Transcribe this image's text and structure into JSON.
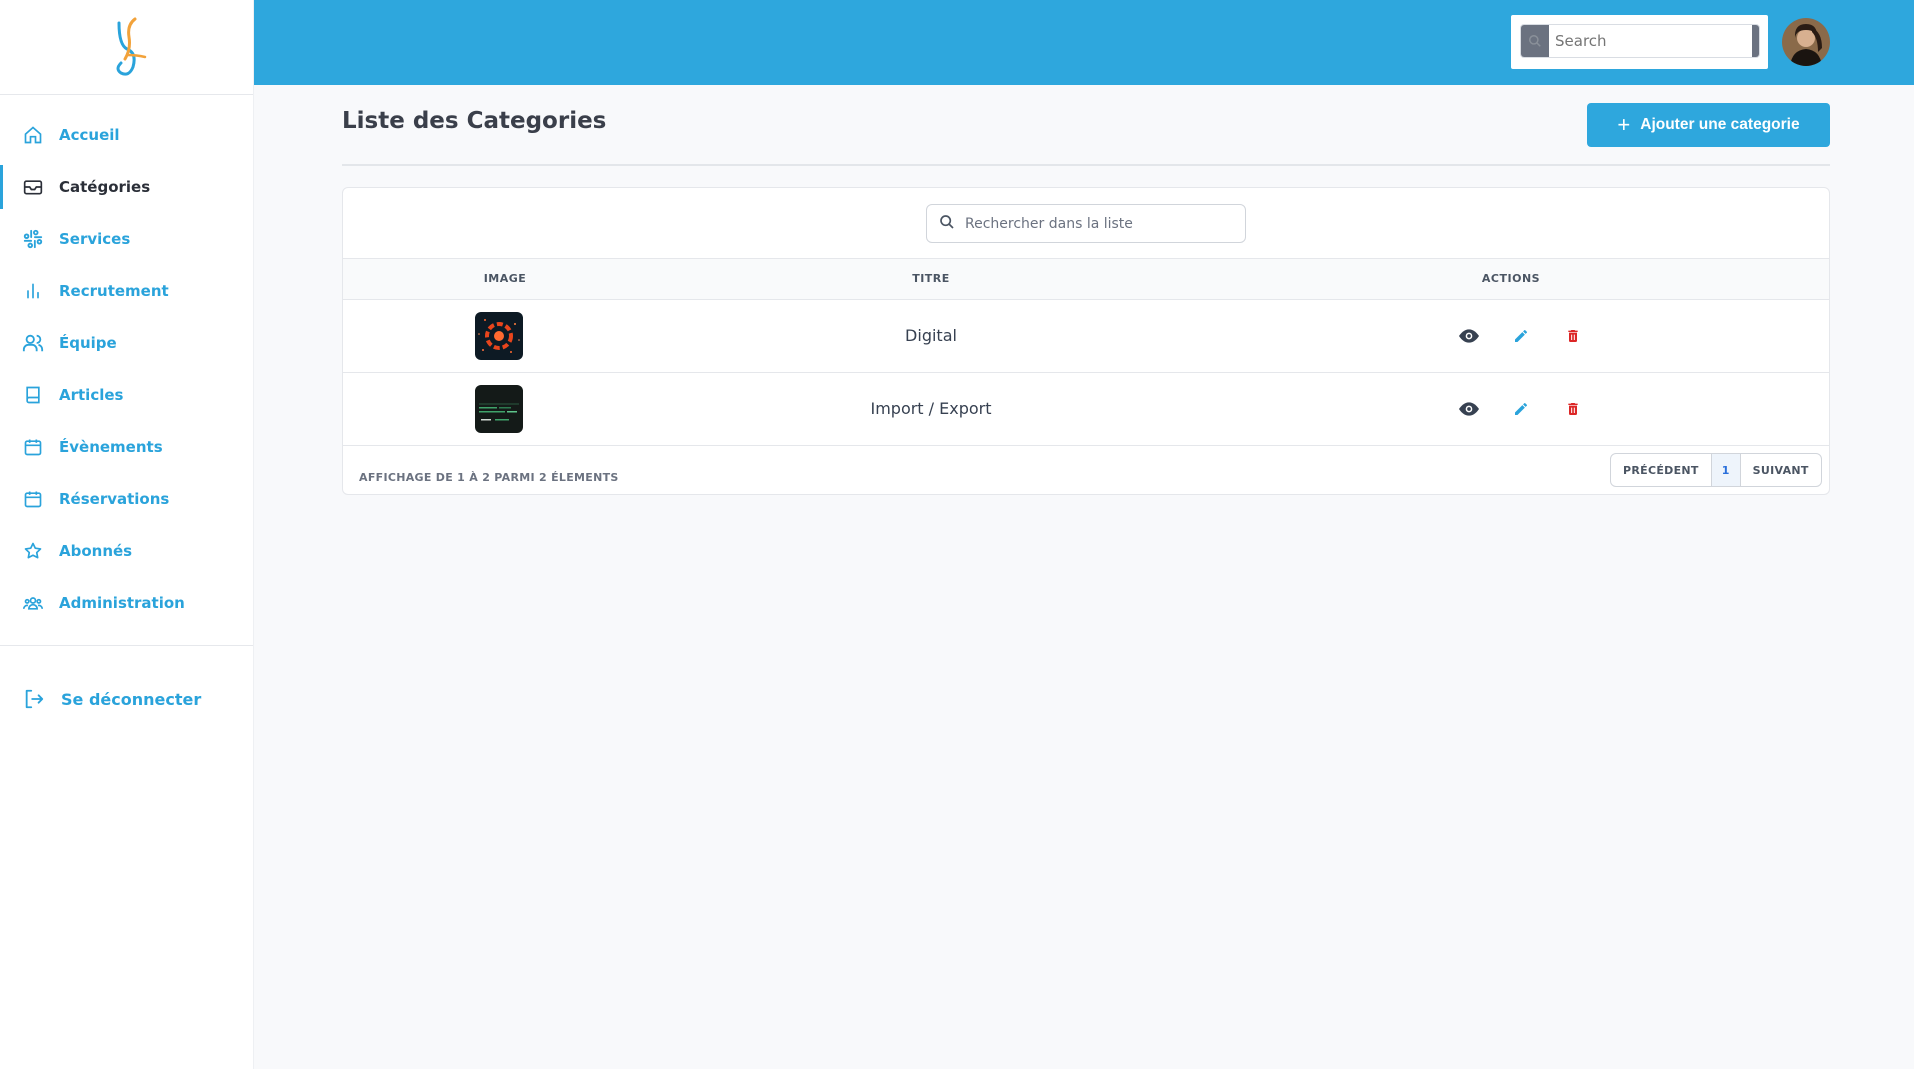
{
  "sidebar": {
    "logo": "brand-logo",
    "items": [
      {
        "label": "Accueil",
        "icon": "home-icon",
        "active": false
      },
      {
        "label": "Catégories",
        "icon": "inbox-icon",
        "active": true
      },
      {
        "label": "Services",
        "icon": "slack-icon",
        "active": false
      },
      {
        "label": "Recrutement",
        "icon": "bar-chart-icon",
        "active": false
      },
      {
        "label": "Équipe",
        "icon": "users-icon",
        "active": false
      },
      {
        "label": "Articles",
        "icon": "book-icon",
        "active": false
      },
      {
        "label": "Évènements",
        "icon": "calendar-icon",
        "active": false
      },
      {
        "label": "Réservations",
        "icon": "calendar-icon",
        "active": false
      },
      {
        "label": "Abonnés",
        "icon": "star-icon",
        "active": false
      },
      {
        "label": "Administration",
        "icon": "admin-group-icon",
        "active": false
      }
    ],
    "logout_label": "Se déconnecter"
  },
  "topbar": {
    "search_placeholder": "Search"
  },
  "main": {
    "title": "Liste des Categories",
    "add_button_label": "Ajouter une categorie",
    "list_search_placeholder": "Rechercher dans la liste",
    "table": {
      "headers": [
        "IMAGE",
        "TITRE",
        "ACTIONS"
      ],
      "rows": [
        {
          "title": "Digital"
        },
        {
          "title": "Import / Export"
        }
      ]
    },
    "footer_info": "AFFICHAGE DE 1 À 2 PARMI 2 ÉLEMENTS",
    "pagination": {
      "prev": "PRÉCÉDENT",
      "page": "1",
      "next": "SUIVANT"
    }
  },
  "colors": {
    "accent": "#2ea7dd",
    "delete": "#dc2626",
    "view": "#374151"
  }
}
